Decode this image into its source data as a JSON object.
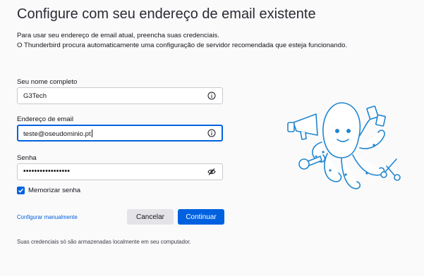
{
  "page": {
    "title": "Configure com seu endereço de email existente",
    "description_line1": "Para usar seu endereço de email atual, preencha suas credenciais.",
    "description_line2": "O Thunderbird procura automaticamente uma configuração de servidor recomendada que esteja funcionando."
  },
  "form": {
    "name": {
      "label": "Seu nome completo",
      "value": "G3Tech",
      "icon": "info-icon"
    },
    "email": {
      "label": "Endereço de email",
      "value": "teste@oseudominio.pt",
      "icon": "info-icon"
    },
    "password": {
      "label": "Senha",
      "masked_value": "•••••••••••••••••",
      "icon": "eye-slash-icon"
    },
    "remember": {
      "label": "Memorizar senha",
      "checked": true
    }
  },
  "actions": {
    "manual_label": "Configurar manualmente",
    "cancel_label": "Cancelar",
    "continue_label": "Continuar"
  },
  "footer": {
    "note": "Suas credenciais só são armazenadas localmente em seu computador."
  },
  "colors": {
    "accent": "#0061e0",
    "mascot": "#3aa0e0"
  }
}
